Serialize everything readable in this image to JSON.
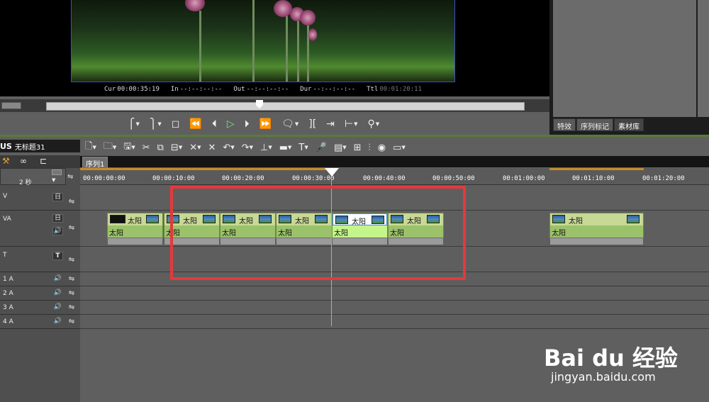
{
  "preview": {
    "timecodes": {
      "cur_label": "Cur",
      "cur_value": "00:00:35:19",
      "in_label": "In",
      "in_value": "--:--:--:--",
      "out_label": "Out",
      "out_value": "--:--:--:--",
      "dur_label": "Dur",
      "dur_value": "--:--:--:--",
      "ttl_label": "Ttl",
      "ttl_value": "00:01:20:11"
    }
  },
  "right_tabs": [
    {
      "label": "特效"
    },
    {
      "label": "序列标记"
    },
    {
      "label": "素材库",
      "active": true
    }
  ],
  "project": {
    "logo": "US",
    "title": "无标题31"
  },
  "sequence_tab": "序列1",
  "zoom_level": "2 秒",
  "ruler_labels": [
    "00:00:00:00",
    "00:00:10:00",
    "00:00:20:00",
    "00:00:30:00",
    "00:00:40:00",
    "00:00:50:00",
    "00:01:00:00",
    "00:01:10:00",
    "00:01:20:00"
  ],
  "tracks": [
    {
      "name": "V",
      "button": "日"
    },
    {
      "name": "VA",
      "button": "日"
    },
    {
      "name": "T",
      "button": "T"
    },
    {
      "name": "1 A"
    },
    {
      "name": "2 A"
    },
    {
      "name": "3 A"
    },
    {
      "name": "4 A"
    }
  ],
  "clips": [
    {
      "title": "太阳",
      "label": "太阳"
    },
    {
      "title": "太阳",
      "label": "太阳"
    },
    {
      "title": "太阳",
      "label": "太阳"
    },
    {
      "title": "太阳",
      "label": "太阳"
    },
    {
      "title": "太阳",
      "label": "太阳",
      "selected": true
    },
    {
      "title": "太阳",
      "label": "太阳"
    },
    {
      "title": "太阳",
      "label": "太阳"
    }
  ],
  "watermark": {
    "brand": "Bai du 经验",
    "url": "jingyan.baidu.com"
  },
  "colors": {
    "accent_green": "#5a7a3a",
    "highlight_red": "#e4393c",
    "clip_green": "#9bc26a",
    "playhead": "#54d3d3"
  }
}
